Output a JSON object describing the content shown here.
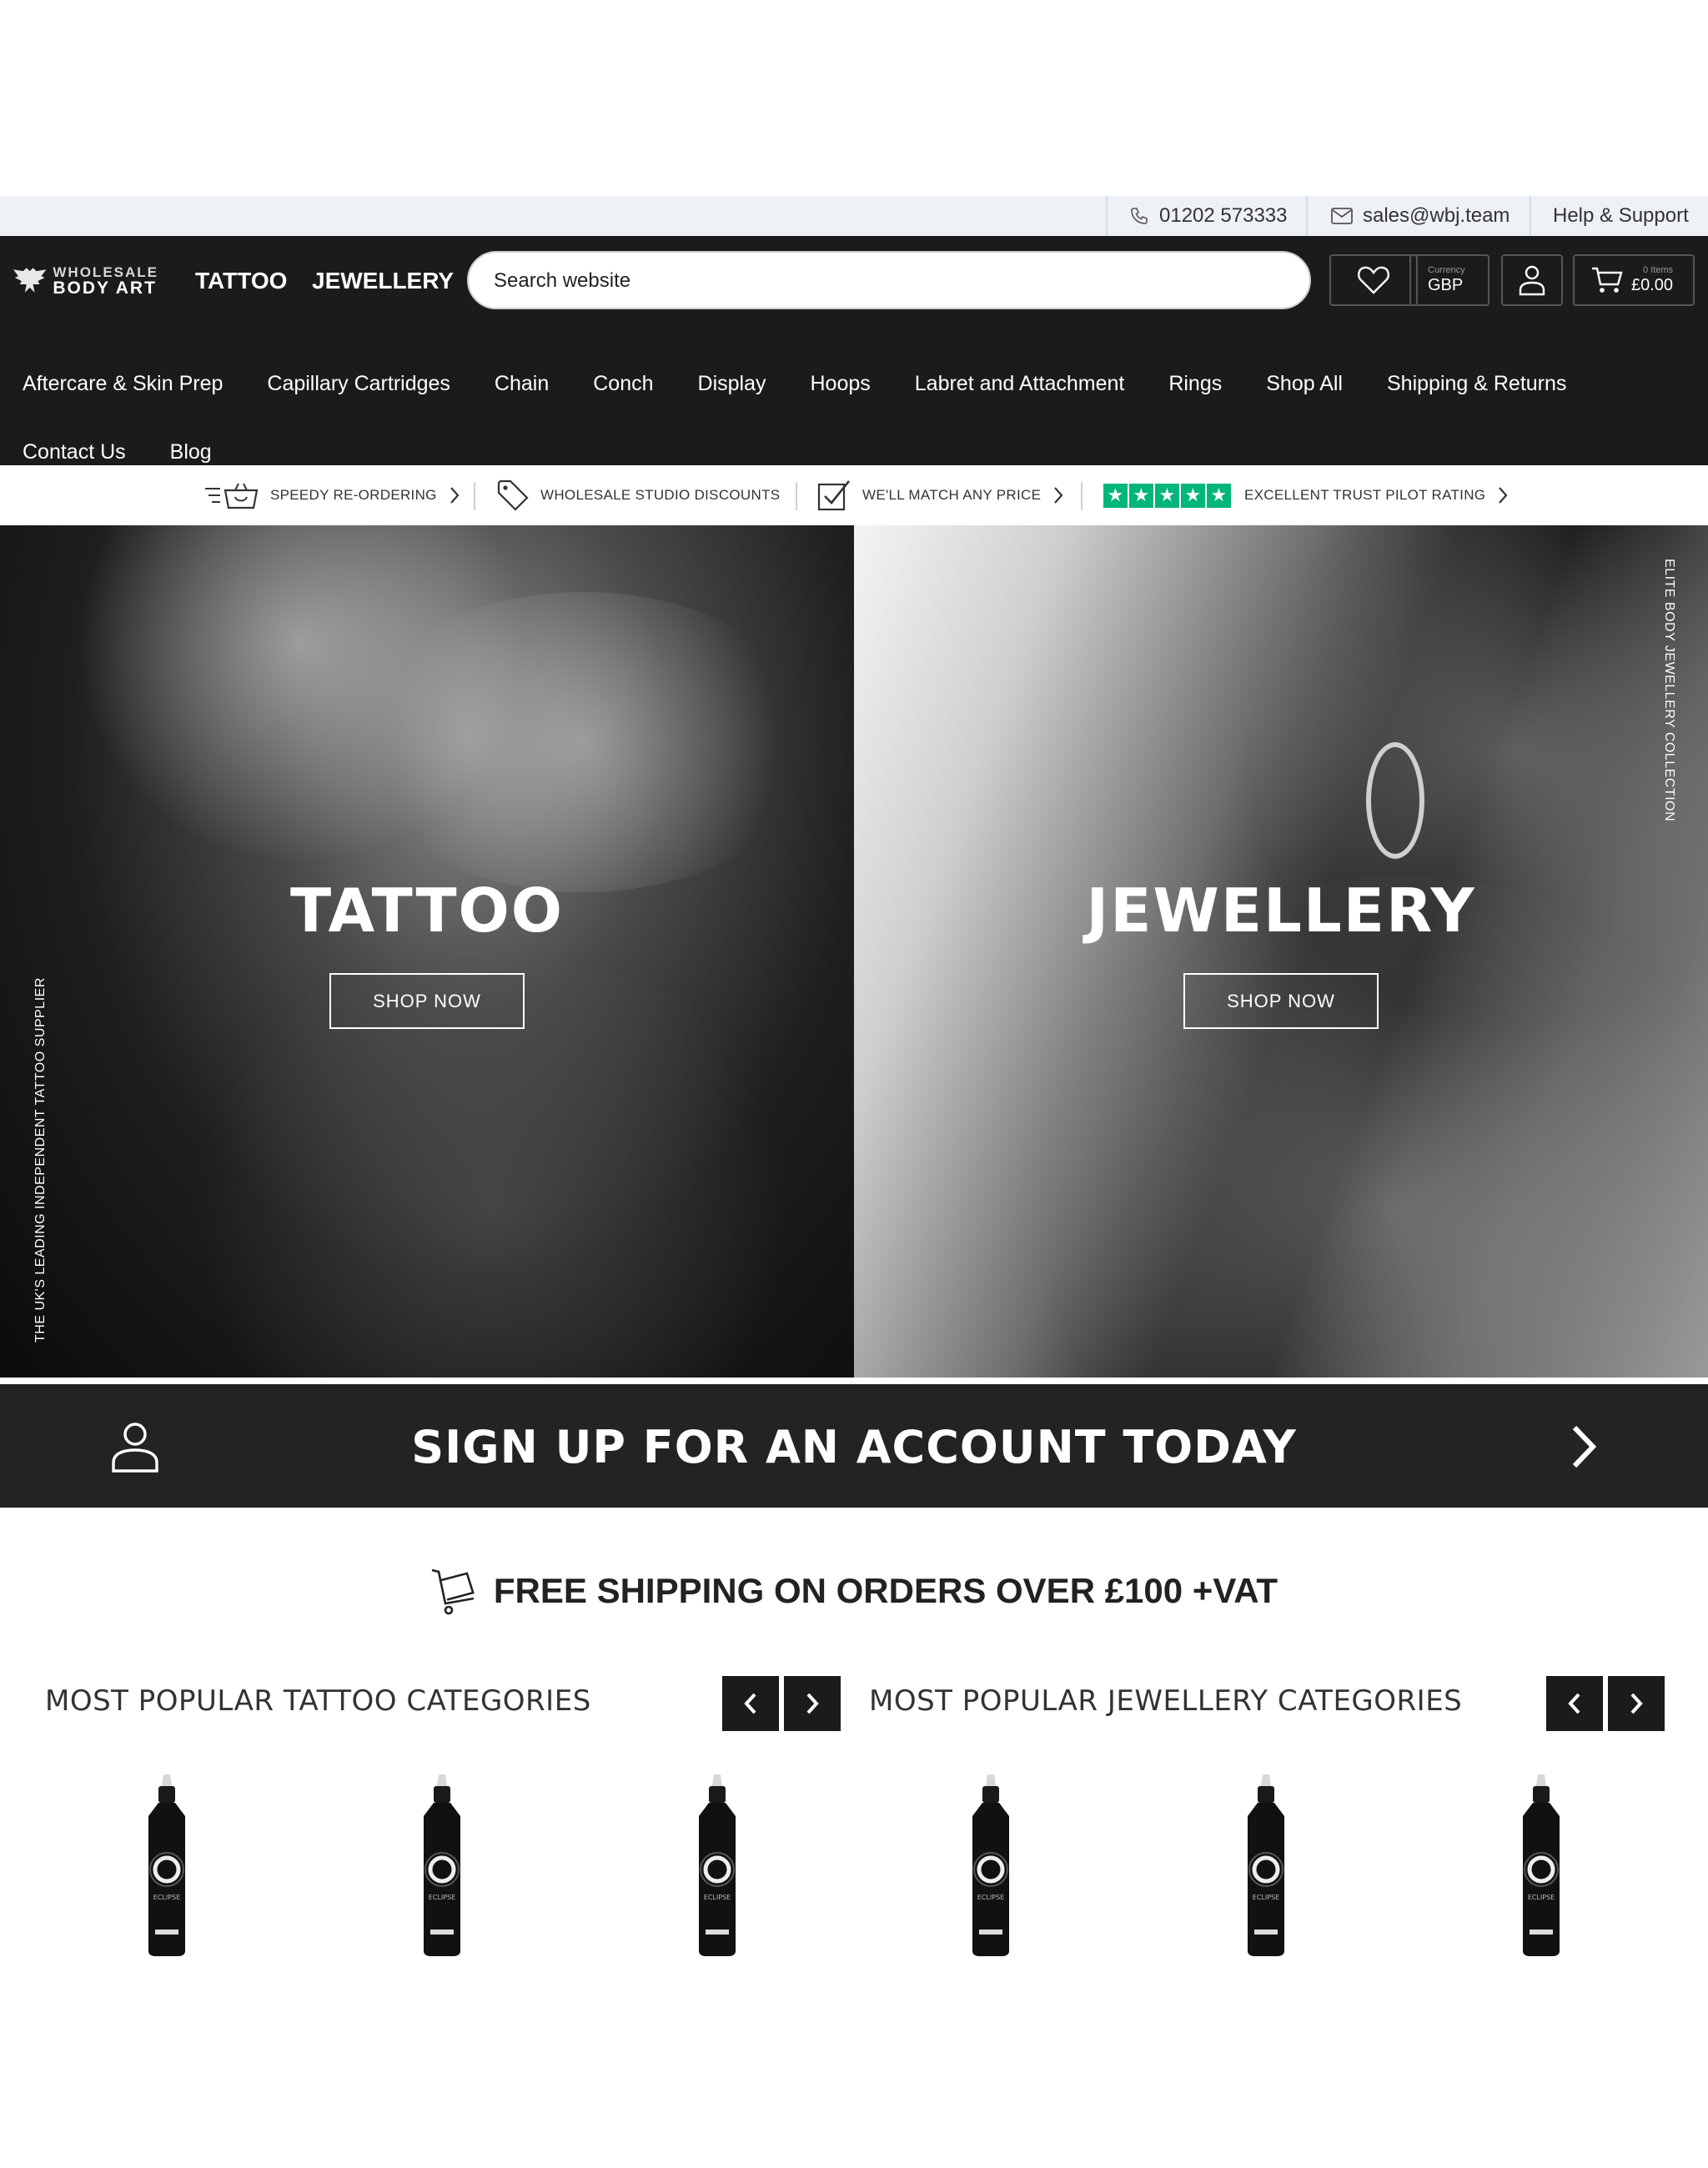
{
  "topbar": {
    "phone": "01202 573333",
    "email": "sales@wbj.team",
    "help": "Help & Support"
  },
  "header": {
    "logo_line1": "WHOLESALE",
    "logo_line2": "BODY ART",
    "nav": [
      "TATTOO",
      "JEWELLERY"
    ],
    "search_placeholder": "Search website",
    "currency_label": "Currency",
    "currency_value": "GBP",
    "cart_items": "0 Items",
    "cart_total": "£0.00"
  },
  "catnav": {
    "row1": [
      "Aftercare & Skin Prep",
      "Capillary Cartridges",
      "Chain",
      "Conch",
      "Display",
      "Hoops",
      "Labret and Attachment",
      "Rings",
      "Shop All",
      "Shipping & Returns"
    ],
    "row2": [
      "Contact Us",
      "Blog"
    ]
  },
  "usp": {
    "reorder": "SPEEDY RE-ORDERING",
    "discounts": "WHOLESALE STUDIO DISCOUNTS",
    "match": "WE'LL MATCH ANY PRICE",
    "trustpilot": "EXCELLENT TRUST PILOT RATING",
    "trustpilot_stars": 5,
    "trustpilot_color": "#00b67a"
  },
  "hero": {
    "tattoo_title": "TATTOO",
    "tattoo_button": "SHOP NOW",
    "tattoo_side": "THE UK'S LEADING INDEPENDENT TATTOO SUPPLIER",
    "jewellery_title": "JEWELLERY",
    "jewellery_button": "SHOP NOW",
    "jewellery_side": "ELITE BODY JEWELLERY COLLECTION"
  },
  "signup": {
    "text": "SIGN UP FOR AN ACCOUNT TODAY"
  },
  "shipping": {
    "text": "FREE SHIPPING ON ORDERS OVER £100 +VAT"
  },
  "popular": {
    "tattoo_title": "MOST POPULAR TATTOO CATEGORIES",
    "jewellery_title": "MOST POPULAR JEWELLERY CATEGORIES",
    "bottle_label": "ECLIPSE"
  }
}
